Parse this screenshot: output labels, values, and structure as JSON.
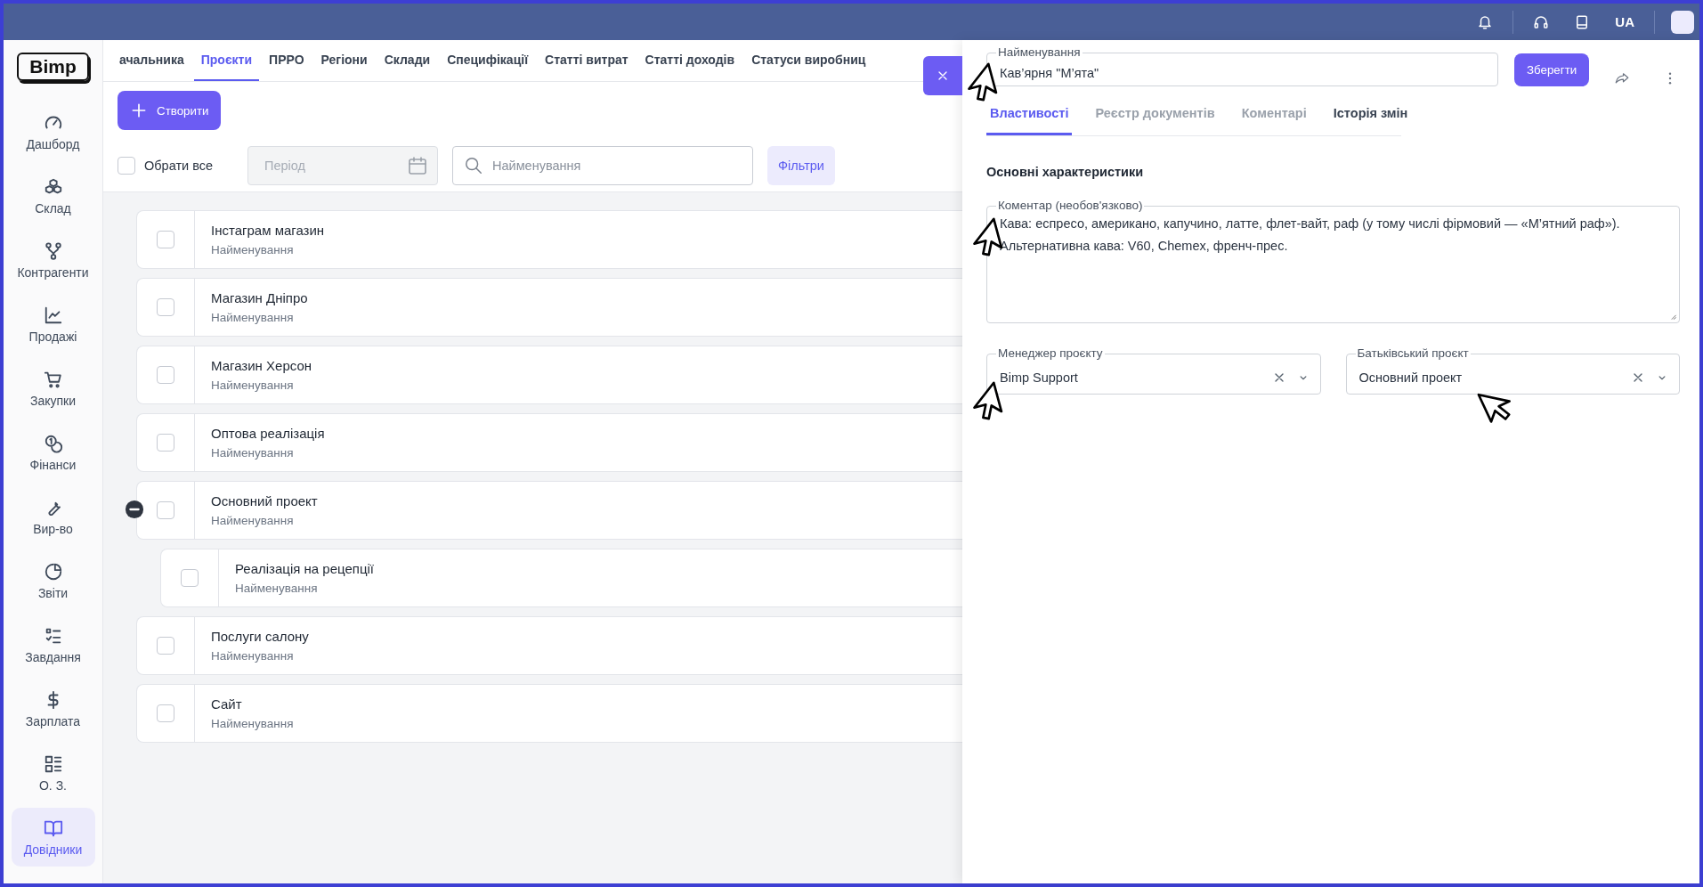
{
  "top_bar": {
    "language": "UA"
  },
  "sidebar": {
    "logo": "Bimp",
    "items": [
      {
        "label": "Дашборд",
        "selected": false
      },
      {
        "label": "Склад",
        "selected": false
      },
      {
        "label": "Контрагенти",
        "selected": false
      },
      {
        "label": "Продажі",
        "selected": false
      },
      {
        "label": "Закупки",
        "selected": false
      },
      {
        "label": "Фінанси",
        "selected": false
      },
      {
        "label": "Вир-во",
        "selected": false
      },
      {
        "label": "Звіти",
        "selected": false
      },
      {
        "label": "Завдання",
        "selected": false
      },
      {
        "label": "Зарплата",
        "selected": false
      },
      {
        "label": "О. З.",
        "selected": false
      },
      {
        "label": "Довідники",
        "selected": true
      }
    ]
  },
  "tabs": [
    {
      "label": "ачальника",
      "selected": false
    },
    {
      "label": "Проєкти",
      "selected": true
    },
    {
      "label": "ПРРО",
      "selected": false
    },
    {
      "label": "Регіони",
      "selected": false
    },
    {
      "label": "Склади",
      "selected": false
    },
    {
      "label": "Специфікації",
      "selected": false
    },
    {
      "label": "Статті витрат",
      "selected": false
    },
    {
      "label": "Статті доходів",
      "selected": false
    },
    {
      "label": "Статуси виробниц",
      "selected": false
    }
  ],
  "create_button": "Створити",
  "filters": {
    "select_all": {
      "label": "Обрати все",
      "checked": false
    },
    "period": {
      "placeholder": "Період"
    },
    "search": {
      "placeholder": "Найменування"
    },
    "filters_button": "Фільтри"
  },
  "projects": [
    {
      "name": "Інстаграм магазин",
      "subtitle": "Найменування",
      "checked": false
    },
    {
      "name": "Магазин Дніпро",
      "subtitle": "Найменування",
      "checked": false
    },
    {
      "name": "Магазин Херсон",
      "subtitle": "Найменування",
      "checked": false
    },
    {
      "name": "Оптова реалізація",
      "subtitle": "Найменування",
      "checked": false
    },
    {
      "name": "Основний проект",
      "subtitle": "Найменування",
      "checked": false,
      "expanded": true,
      "children": [
        {
          "name": "Реалізація на рецепції",
          "subtitle": "Найменування",
          "checked": false
        }
      ]
    },
    {
      "name": "Послуги салону",
      "subtitle": "Найменування",
      "checked": false
    },
    {
      "name": "Сайт",
      "subtitle": "Найменування",
      "checked": false
    }
  ],
  "panel": {
    "name_field": {
      "label": "Найменування",
      "value": "Кав’ярня \"М’ята\""
    },
    "save_button": "Зберегти",
    "tabs": [
      {
        "label": "Властивості",
        "selected": true,
        "disabled": false
      },
      {
        "label": "Реєстр документів",
        "selected": false,
        "disabled": true
      },
      {
        "label": "Коментарі",
        "selected": false,
        "disabled": true
      },
      {
        "label": "Історія змін",
        "selected": false,
        "disabled": false
      }
    ],
    "section_title": "Основні характеристики",
    "comment": {
      "label": "Коментар (необов'язково)",
      "value": "Кава: еспресо, американо, капучино, латте, флет-вайт, раф (у тому числі фірмовий — «М’ятний раф»).\nАльтернативна кава: V60, Chemex, френч-прес."
    },
    "manager": {
      "label": "Менеджер проєкту",
      "value": "Bimp Support"
    },
    "parent_project": {
      "label": "Батьківський проєкт",
      "value": "Основний проект"
    }
  }
}
